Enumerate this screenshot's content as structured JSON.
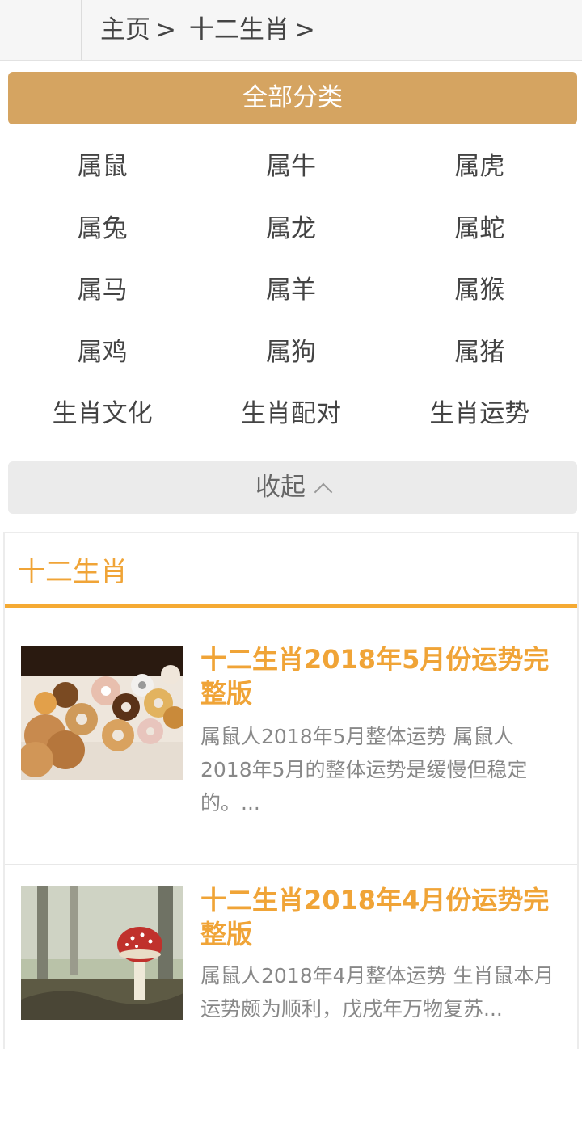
{
  "breadcrumb": {
    "home": "主页",
    "sep1": ">",
    "current": "十二生肖",
    "sep2": ">"
  },
  "all_categories_label": "全部分类",
  "categories": [
    [
      "属鼠",
      "属牛",
      "属虎"
    ],
    [
      "属兔",
      "属龙",
      "属蛇"
    ],
    [
      "属马",
      "属羊",
      "属猴"
    ],
    [
      "属鸡",
      "属狗",
      "属猪"
    ],
    [
      "生肖文化",
      "生肖配对",
      "生肖运势"
    ]
  ],
  "collapse_label": "收起",
  "section_title": "十二生肖",
  "articles": [
    {
      "title": "十二生肖2018年5月份运势完整版",
      "summary": "属鼠人2018年5月整体运势 属鼠人2018年5月的整体运势是缓慢但稳定的。...",
      "image": "donuts-cookies-photo"
    },
    {
      "title": "十二生肖2018年4月份运势完整版",
      "summary": "属鼠人2018年4月整体运势 生肖鼠本月运势颇为顺利，戊戌年万物复苏...",
      "image": "mushroom-forest-photo"
    }
  ],
  "colors": {
    "accent": "#f0a437",
    "category_bar": "#d5a461",
    "collapse_bg": "#ebebeb"
  }
}
